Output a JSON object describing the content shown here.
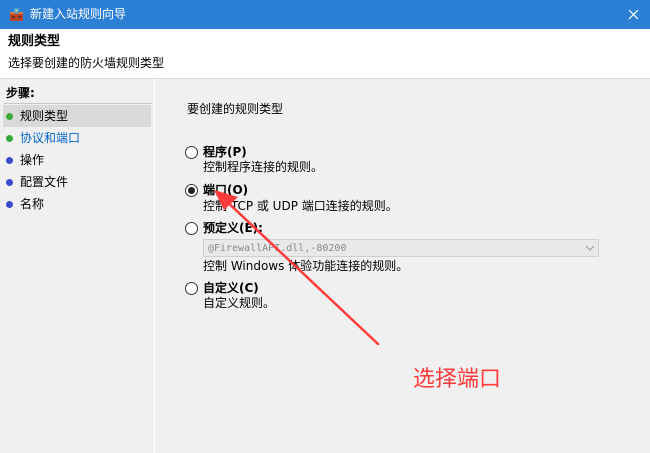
{
  "window": {
    "title": "新建入站规则向导"
  },
  "header": {
    "title": "规则类型",
    "subtitle": "选择要创建的防火墙规则类型"
  },
  "steps": {
    "title": "步骤:",
    "items": [
      {
        "label": "规则类型",
        "status": "current",
        "dot_color": "#3aa83a"
      },
      {
        "label": "协议和端口",
        "status": "next",
        "dot_color": "#3aa83a"
      },
      {
        "label": "操作",
        "status": "pending",
        "dot_color": "#3b4bc9"
      },
      {
        "label": "配置文件",
        "status": "pending",
        "dot_color": "#3b4bc9"
      },
      {
        "label": "名称",
        "status": "pending",
        "dot_color": "#3b4bc9"
      }
    ]
  },
  "content": {
    "question": "要创建的规则类型",
    "options": [
      {
        "label": "程序(P)",
        "description": "控制程序连接的规则。",
        "checked": false
      },
      {
        "label": "端口(O)",
        "description": "控制 TCP 或 UDP 端口连接的规则。",
        "checked": true
      },
      {
        "label": "预定义(E):",
        "description": "控制 Windows 体验功能连接的规则。",
        "checked": false
      },
      {
        "label": "自定义(C)",
        "description": "自定义规则。",
        "checked": false
      }
    ],
    "predefined_value": "@FirewallAPI.dll,-80200"
  },
  "annotation": {
    "text": "选择端口",
    "color": "#ff3b3b"
  },
  "colors": {
    "titlebar": "#2b7fd4",
    "panel": "#f0f0f0",
    "link": "#0066cc"
  }
}
